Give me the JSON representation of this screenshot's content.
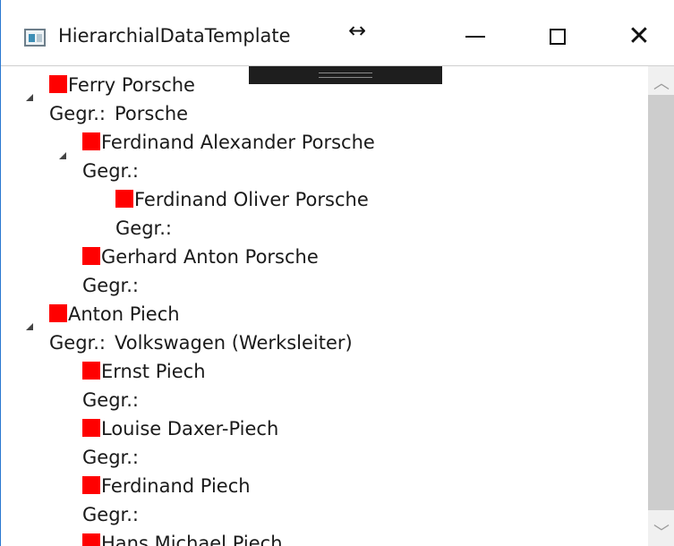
{
  "window": {
    "title": "HierarchialDataTemplate",
    "cursor_glyph": "↔",
    "minimize_glyph": "",
    "close_glyph": "✕"
  },
  "tree": {
    "gegr_label": "Gegr.:",
    "nodes": [
      {
        "name": "Ferry Porsche",
        "founded": "Porsche",
        "expanded": true
      },
      {
        "name": "Ferdinand Alexander Porsche",
        "founded": "",
        "expanded": true
      },
      {
        "name": "Ferdinand Oliver Porsche",
        "founded": ""
      },
      {
        "name": "Gerhard Anton Porsche",
        "founded": ""
      },
      {
        "name": "Anton Piech",
        "founded": "Volkswagen (Werksleiter)",
        "expanded": true
      },
      {
        "name": "Ernst Piech",
        "founded": ""
      },
      {
        "name": "Louise Daxer-Piech",
        "founded": ""
      },
      {
        "name": "Ferdinand Piech",
        "founded": ""
      },
      {
        "name": "Hans Michael Piech",
        "founded": ""
      }
    ]
  },
  "scrollbar": {
    "up_glyph": "︿",
    "down_glyph": "﹀"
  },
  "colors": {
    "node_square": "#ff0000",
    "window_border": "#2b79d1",
    "debug_bar": "#1e1e1e"
  }
}
